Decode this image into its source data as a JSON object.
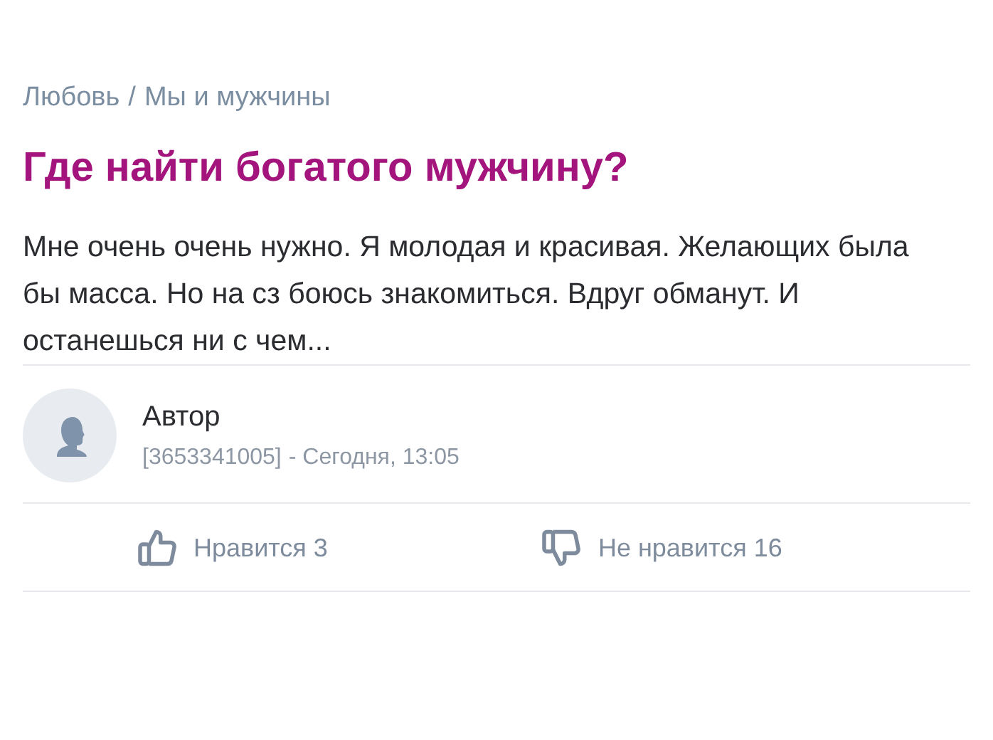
{
  "breadcrumb": [
    "Любовь",
    "Мы и мужчины"
  ],
  "breadcrumb_separator": "/",
  "title": "Где найти богатого мужчину?",
  "body": "Мне очень очень нужно. Я молодая и красивая. Желающих была бы масса. Но на сз боюсь знакомиться. Вдруг обманут. И останешься ни с чем...",
  "author": {
    "name": "Автор",
    "id": "[3653341005]",
    "time": "- Сегодня, 13:05"
  },
  "reactions": [
    {
      "kind": "like",
      "label": "Нравится 3"
    },
    {
      "kind": "dislike",
      "label": "Не нравится 16"
    }
  ]
}
